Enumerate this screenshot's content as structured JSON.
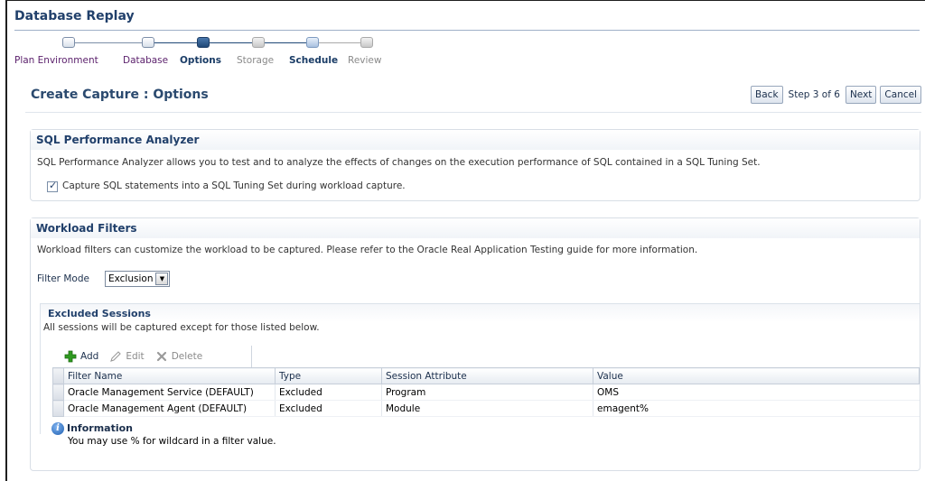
{
  "app": {
    "title": "Database Replay"
  },
  "train": {
    "steps": [
      {
        "label": "Plan Environment",
        "state": "visited"
      },
      {
        "label": "Database",
        "state": "visited"
      },
      {
        "label": "Options",
        "state": "current"
      },
      {
        "label": "Storage",
        "state": "upcoming"
      },
      {
        "label": "Schedule",
        "state": "link"
      },
      {
        "label": "Review",
        "state": "upcoming"
      }
    ]
  },
  "page": {
    "heading": "Create Capture : Options"
  },
  "nav": {
    "back_label": "Back",
    "step_text": "Step 3 of 6",
    "next_label": "Next",
    "cancel_label": "Cancel"
  },
  "spa": {
    "heading": "SQL Performance Analyzer",
    "description": "SQL Performance Analyzer allows you to test and to analyze the effects of changes on the execution performance of SQL contained in a SQL Tuning Set.",
    "checkbox_label": "Capture SQL statements into a SQL Tuning Set during workload capture.",
    "checkbox_checked": true
  },
  "filters": {
    "heading": "Workload Filters",
    "description": "Workload filters can customize the workload to be captured. Please refer to the Oracle Real Application Testing guide for more information.",
    "filter_mode_label": "Filter Mode",
    "filter_mode_value": "Exclusion"
  },
  "excluded": {
    "heading": "Excluded Sessions",
    "description": "All sessions will be captured except for those listed below.",
    "toolbar": {
      "add_label": "Add",
      "edit_label": "Edit",
      "delete_label": "Delete"
    },
    "columns": [
      "Filter Name",
      "Type",
      "Session Attribute",
      "Value"
    ],
    "rows": [
      [
        "Oracle Management Service (DEFAULT)",
        "Excluded",
        "Program",
        "OMS"
      ],
      [
        "Oracle Management Agent (DEFAULT)",
        "Excluded",
        "Module",
        "emagent%"
      ]
    ]
  },
  "info": {
    "title": "Information",
    "text": "You may use % for wildcard in a filter value."
  },
  "colors": {
    "accent": "#21406b",
    "current_step": "#1f4877",
    "visited_step": "#5a1f6b",
    "add_icon": "#2e9a1f"
  }
}
